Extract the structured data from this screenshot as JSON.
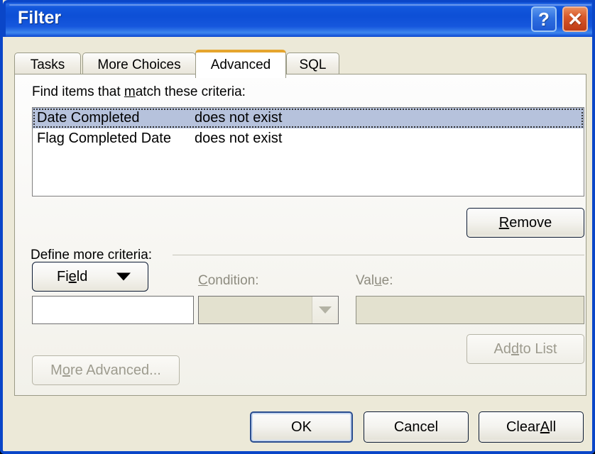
{
  "window": {
    "title": "Filter",
    "help_button": "?",
    "close_button": "✕",
    "accent_blue": "#0a46c8",
    "panel_bg": "#ece9d8",
    "active_tab_accent": "#e5a52e",
    "selection_color": "#b6c2dc"
  },
  "tabs": [
    {
      "label": "Tasks",
      "active": false
    },
    {
      "label": "More Choices",
      "active": false
    },
    {
      "label": "Advanced",
      "active": true
    },
    {
      "label": "SQL",
      "active": false
    }
  ],
  "advanced": {
    "criteria_label_pre": "Find items that ",
    "criteria_label_accel": "m",
    "criteria_label_post": "atch these criteria:",
    "criteria_list": [
      {
        "field": "Date Completed",
        "condition": "does not exist",
        "selected": true
      },
      {
        "field": "Flag Completed Date",
        "condition": "does not exist",
        "selected": false
      }
    ],
    "remove_pre": "",
    "remove_accel": "R",
    "remove_post": "emove",
    "define_label": "Define more criteria:",
    "field_button_pre": "Fi",
    "field_button_accel": "e",
    "field_button_post": "ld",
    "field_value": "",
    "condition_label_accel": "C",
    "condition_label_post": "ondition:",
    "condition_value": "",
    "value_label_pre": "Val",
    "value_label_accel": "u",
    "value_label_post": "e:",
    "value_value": "",
    "add_to_list_pre": "Ad",
    "add_to_list_accel": "d",
    "add_to_list_post": " to List",
    "more_advanced_pre": "M",
    "more_advanced_accel": "o",
    "more_advanced_post": "re Advanced..."
  },
  "footer": {
    "ok": "OK",
    "cancel": "Cancel",
    "clear_all_pre": "Clear ",
    "clear_all_accel": "A",
    "clear_all_post": "ll"
  }
}
